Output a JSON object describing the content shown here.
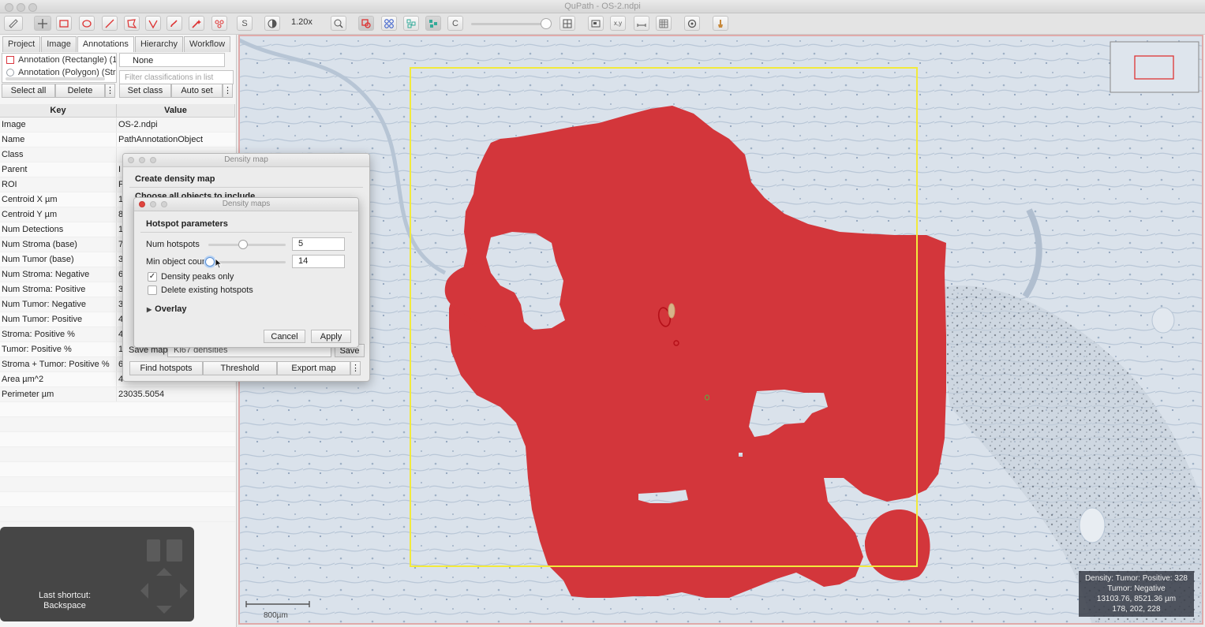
{
  "window": {
    "title": "QuPath - OS-2.ndpi"
  },
  "toolbar": {
    "zoom": "1.20x",
    "tools": [
      "move-tool-icon",
      "rectangle-tool-icon",
      "ellipse-tool-icon",
      "line-tool-icon",
      "polygon-tool-icon",
      "polyline-tool-icon",
      "brush-tool-icon",
      "wand-tool-icon",
      "points-tool-icon"
    ],
    "selection_mode_label": "S",
    "c_label": "C",
    "xy_label": "x,y"
  },
  "left_panel": {
    "tabs": [
      "Project",
      "Image",
      "Annotations",
      "Hierarchy",
      "Workflow"
    ],
    "active_tab": "Annotations",
    "annotations": [
      {
        "label": "Annotation (Rectangle) (1(",
        "color": "#d9363e"
      },
      {
        "label": "Annotation (Polygon) (Stro",
        "color": "#9aa0a8"
      }
    ],
    "classification_selected": "None",
    "filter_placeholder": "Filter classifications in list",
    "buttons": {
      "select_all": "Select all",
      "delete": "Delete",
      "set_class": "Set class",
      "auto_set": "Auto set",
      "more": "⋮"
    },
    "table_headers": {
      "key": "Key",
      "value": "Value"
    },
    "rows": [
      {
        "key": "Image",
        "value": "OS-2.ndpi"
      },
      {
        "key": "Name",
        "value": "PathAnnotationObject"
      },
      {
        "key": "Class",
        "value": ""
      },
      {
        "key": "Parent",
        "value": "I"
      },
      {
        "key": "ROI",
        "value": "F"
      },
      {
        "key": "Centroid X µm",
        "value": "1"
      },
      {
        "key": "Centroid Y µm",
        "value": "8"
      },
      {
        "key": "Num Detections",
        "value": "1"
      },
      {
        "key": "Num Stroma (base)",
        "value": "7"
      },
      {
        "key": "Num Tumor (base)",
        "value": "3"
      },
      {
        "key": "Num Stroma: Negative",
        "value": "6"
      },
      {
        "key": "Num Stroma: Positive",
        "value": "3"
      },
      {
        "key": "Num Tumor: Negative",
        "value": "3"
      },
      {
        "key": "Num Tumor: Positive",
        "value": "4"
      },
      {
        "key": "Stroma: Positive %",
        "value": "4"
      },
      {
        "key": "Tumor: Positive %",
        "value": "1"
      },
      {
        "key": "Stroma + Tumor: Positive %",
        "value": "6"
      },
      {
        "key": "Area µm^2",
        "value": "4"
      },
      {
        "key": "Perimeter µm",
        "value": "23035.5054"
      }
    ]
  },
  "shortcut": {
    "label": "Last shortcut:",
    "value": "Backspace"
  },
  "density_map_dialog": {
    "title": "Density map",
    "heading": "Create density map",
    "subheading": "Choose all objects to include",
    "save_map_label": "Save map",
    "save_map_value": "Ki67 densities",
    "save_button": "Save",
    "buttons": {
      "find_hotspots": "Find hotspots",
      "threshold": "Threshold",
      "export_map": "Export map",
      "more": "⋮"
    }
  },
  "density_maps_dialog": {
    "title": "Density maps",
    "section": "Hotspot parameters",
    "num_hotspots_label": "Num hotspots",
    "num_hotspots_value": "5",
    "num_hotspots_level": 0.45,
    "min_object_count_label": "Min object count",
    "min_object_count_value": "14",
    "min_object_count_level": 0.02,
    "density_peaks_label": "Density peaks only",
    "density_peaks_checked": true,
    "delete_existing_label": "Delete existing hotspots",
    "delete_existing_checked": false,
    "overlay_label": "Overlay",
    "cancel": "Cancel",
    "apply": "Apply"
  },
  "viewer": {
    "scalebar_label": "800µm",
    "info": {
      "line1": "Density: Tumor: Positive: 328",
      "line2": "Tumor: Negative",
      "line3": "13103.76, 8521.36 µm",
      "line4": "178, 202, 228"
    },
    "density_color": "#d3363b",
    "selection_color": "#f2ea3c"
  }
}
